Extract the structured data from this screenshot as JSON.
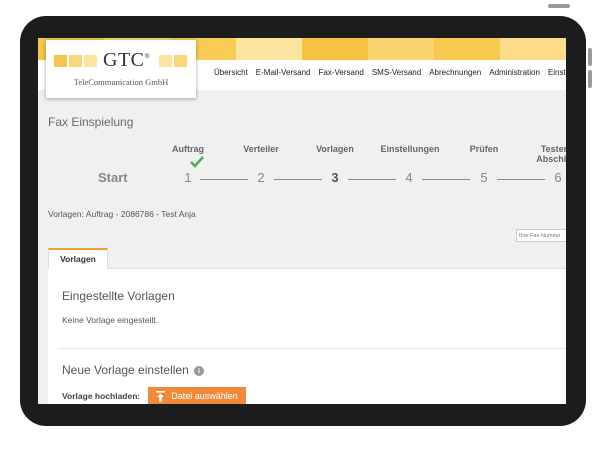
{
  "logo": {
    "name": "GTC",
    "reg": "®",
    "subtitle": "TeleCommunication GmbH"
  },
  "nav": [
    "Übersicht",
    "E-Mail-Versand",
    "Fax-Versand",
    "SMS-Versand",
    "Abrechnungen",
    "Administration",
    "Einstel"
  ],
  "page_title": "Fax Einspielung",
  "wizard": {
    "start_label": "Start",
    "steps": [
      {
        "label": "Auftrag",
        "number": "1",
        "done": true
      },
      {
        "label": "Verteiler",
        "number": "2"
      },
      {
        "label": "Vorlagen",
        "number": "3",
        "current": true
      },
      {
        "label": "Einstellungen",
        "number": "4"
      },
      {
        "label": "Prüfen",
        "number": "5"
      },
      {
        "label": "Testen",
        "label2": "Abschlie",
        "number": "6"
      }
    ]
  },
  "vorlagen_info": "Vorlagen:  Auftrag  -   2086786   - Test Anja",
  "fax_input": {
    "placeholder": "Ihre Fax-Numme"
  },
  "tab": {
    "label": "Vorlagen"
  },
  "eingestellte": {
    "title": "Eingestellte Vorlagen",
    "text": "Keine Vorlage eingestellt."
  },
  "neue": {
    "title": "Neue Vorlage einstellen",
    "upload_label": "Vorlage hochladen:",
    "button": "Datei auswählen"
  },
  "colors": {
    "accent": "#f08a3a",
    "stripe": [
      "#f6c64a",
      "#f9d77a",
      "#f7cb55",
      "#fbe3a0",
      "#f5c244",
      "#f9d470",
      "#f7c94e",
      "#fadc8a"
    ]
  }
}
